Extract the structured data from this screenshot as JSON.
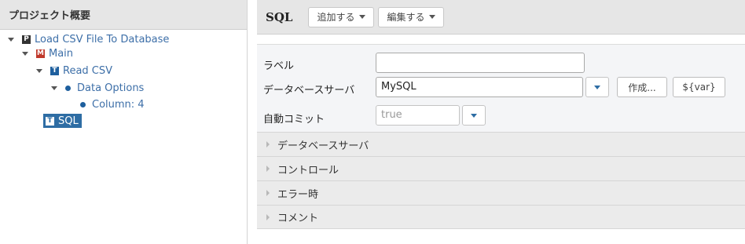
{
  "left_panel": {
    "title": "プロジェクト概要",
    "tree": [
      {
        "label": "Load CSV File To Database",
        "icon": "P",
        "icon_name": "project-icon"
      },
      {
        "label": "Main",
        "icon": "M",
        "icon_name": "main-job-icon"
      },
      {
        "label": "Read CSV",
        "icon": "T",
        "icon_name": "task-icon"
      },
      {
        "label": "Data Options",
        "icon_name": "bullet-icon"
      },
      {
        "label": "Column: 4",
        "icon_name": "bullet-icon"
      },
      {
        "label": "SQL",
        "icon": "T",
        "icon_name": "task-icon",
        "selected": true
      }
    ]
  },
  "toolbar": {
    "title": "SQL",
    "add_label": "追加する",
    "edit_label": "編集する"
  },
  "form": {
    "label_label": "ラベル",
    "label_value": "",
    "dbserver_label": "データベースサーバ",
    "dbserver_value": "MySQL",
    "create_button": "作成...",
    "var_button": "${var}",
    "autocommit_label": "自動コミット",
    "autocommit_value": "true"
  },
  "sections": [
    {
      "label": "データベースサーバ"
    },
    {
      "label": "コントロール"
    },
    {
      "label": "エラー時"
    },
    {
      "label": "コメント"
    }
  ],
  "colors": {
    "accent": "#2e6da4",
    "tree_text": "#3d6fa8",
    "main_icon": "#c0392b",
    "header_bg": "#e6e6e6"
  }
}
